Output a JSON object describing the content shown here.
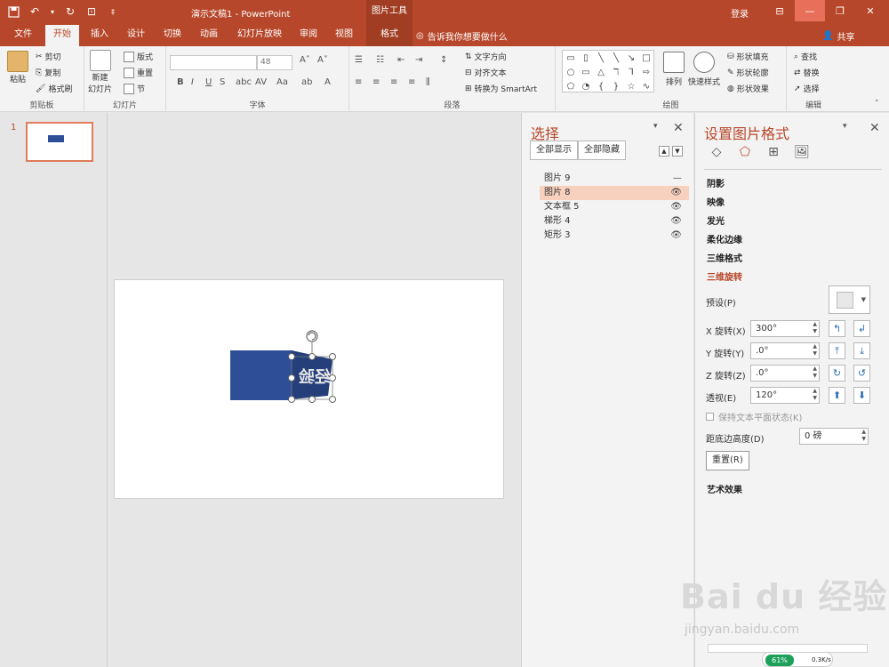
{
  "window": {
    "title": "演示文稿1 - PowerPoint",
    "context_tab_group": "图片工具",
    "login": "登录",
    "share": "共享",
    "tell_me": "告诉我你想要做什么"
  },
  "tabs": [
    {
      "label": "文件"
    },
    {
      "label": "开始"
    },
    {
      "label": "插入"
    },
    {
      "label": "设计"
    },
    {
      "label": "切换"
    },
    {
      "label": "动画"
    },
    {
      "label": "幻灯片放映"
    },
    {
      "label": "审阅"
    },
    {
      "label": "视图"
    },
    {
      "label": "格式"
    }
  ],
  "ribbon": {
    "clipboard": {
      "paste": "粘贴",
      "cut": "剪切",
      "copy": "复制",
      "format_painter": "格式刷",
      "label": "剪贴板"
    },
    "slides": {
      "new_slide_1": "新建",
      "new_slide_2": "幻灯片",
      "layout": "版式",
      "reset": "重置",
      "section": "节",
      "label": "幻灯片"
    },
    "font": {
      "size": "48",
      "label": "字体"
    },
    "paragraph": {
      "text_direction": "文字方向",
      "align_text": "对齐文本",
      "smartart": "转换为 SmartArt",
      "label": "段落"
    },
    "drawing": {
      "arrange": "排列",
      "quick_styles": "快速样式",
      "shape_fill": "形状填充",
      "shape_outline": "形状轮廓",
      "shape_effects": "形状效果",
      "label": "绘图"
    },
    "editing": {
      "find": "查找",
      "replace": "替换",
      "select": "选择",
      "label": "编辑"
    }
  },
  "slides_pane": {
    "number": "1"
  },
  "selection_pane": {
    "title": "选择",
    "show_all": "全部显示",
    "hide_all": "全部隐藏",
    "layers": [
      {
        "name": "图片 9",
        "visible": false
      },
      {
        "name": "图片 8",
        "visible": true,
        "selected": true
      },
      {
        "name": "文本框 5",
        "visible": true
      },
      {
        "name": "梯形 4",
        "visible": true
      },
      {
        "name": "矩形 3",
        "visible": true
      }
    ]
  },
  "format_pane": {
    "title": "设置图片格式",
    "sections": {
      "shadow": "阴影",
      "reflection": "映像",
      "glow": "发光",
      "soft_edges": "柔化边缘",
      "format_3d": "三维格式",
      "rotation_3d": "三维旋转",
      "artistic": "艺术效果"
    },
    "preset_label": "预设(P)",
    "x_label": "X 旋转(X)",
    "x_value": "300°",
    "y_label": "Y 旋转(Y)",
    "y_value": ".0°",
    "z_label": "Z 旋转(Z)",
    "z_value": ".0°",
    "persp_label": "透视(E)",
    "persp_value": "120°",
    "keep_text_flat": "保持文本平面状态(K)",
    "distance_label": "距底边高度(D)",
    "distance_value": "0 磅",
    "reset_button": "重置(R)"
  },
  "slide_content": {
    "image_text": "经验"
  },
  "watermark": {
    "brand": "Bai du 经验",
    "url": "jingyan.baidu.com"
  },
  "tray": {
    "percent": "61%",
    "speed": "0.3K/s"
  },
  "colors": {
    "accent": "#b7472a",
    "shape_blue": "#2e4f98",
    "selected_row": "#f8d0be"
  }
}
